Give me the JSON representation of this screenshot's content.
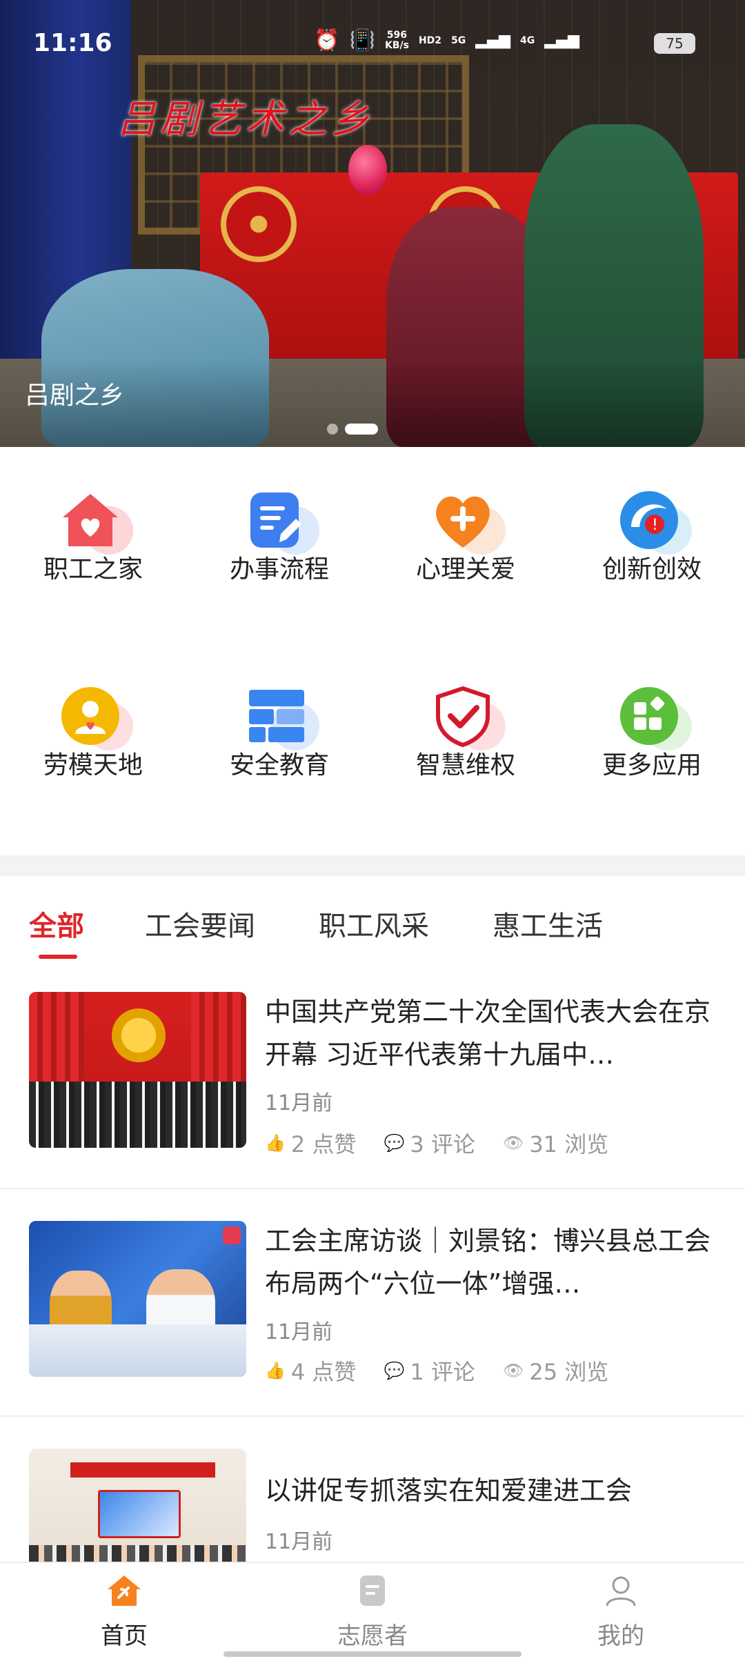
{
  "status_bar": {
    "time": "11:16",
    "net_speed_value": "596",
    "net_speed_unit": "KB/s",
    "hd_label": "HD",
    "hd_sub": "2",
    "network1": "5G",
    "network2": "4G",
    "battery": "75",
    "alarm_icon": "alarm-icon",
    "vibrate_icon": "vibrate-icon"
  },
  "banner": {
    "calligraphy": "吕剧艺术之乡",
    "caption": "吕剧之乡",
    "slide_count": 2,
    "active_slide": 2
  },
  "quick_actions": [
    {
      "label": "职工之家",
      "icon": "home-heart-icon",
      "color": "#f0525a"
    },
    {
      "label": "办事流程",
      "icon": "document-edit-icon",
      "color": "#3e7ef0"
    },
    {
      "label": "心理关爱",
      "icon": "heart-plus-icon",
      "color": "#f5821f"
    },
    {
      "label": "创新创效",
      "icon": "innovation-icon",
      "color": "#2a8de8"
    },
    {
      "label": "劳模天地",
      "icon": "model-worker-icon",
      "color": "#f5b800"
    },
    {
      "label": "安全教育",
      "icon": "safety-grid-icon",
      "color": "#3a86f0"
    },
    {
      "label": "智慧维权",
      "icon": "shield-check-icon",
      "color": "#d4192d"
    },
    {
      "label": "更多应用",
      "icon": "more-apps-icon",
      "color": "#5cbe3a"
    }
  ],
  "tabs": [
    {
      "label": "全部",
      "active": true
    },
    {
      "label": "工会要闻",
      "active": false
    },
    {
      "label": "职工风采",
      "active": false
    },
    {
      "label": "惠工生活",
      "active": false
    }
  ],
  "news": [
    {
      "title": "中国共产党第二十次全国代表大会在京开幕 习近平代表第十九届中…",
      "time": "11月前",
      "likes": "2 点赞",
      "comments": "3 评论",
      "views": "31 浏览"
    },
    {
      "title": "工会主席访谈｜刘景铭：博兴县总工会布局两个“六位一体”增强…",
      "time": "11月前",
      "likes": "4 点赞",
      "comments": "1 评论",
      "views": "25 浏览"
    },
    {
      "title": "以讲促专抓落实在知爱建进工会",
      "time": "11月前"
    }
  ],
  "bottom_nav": [
    {
      "label": "首页",
      "icon": "home-party-icon",
      "active": true
    },
    {
      "label": "志愿者",
      "icon": "volunteer-doc-icon",
      "active": false
    },
    {
      "label": "我的",
      "icon": "profile-icon",
      "active": false
    }
  ],
  "colors": {
    "accent": "#e0242a",
    "nav_active": "#f5821f"
  }
}
